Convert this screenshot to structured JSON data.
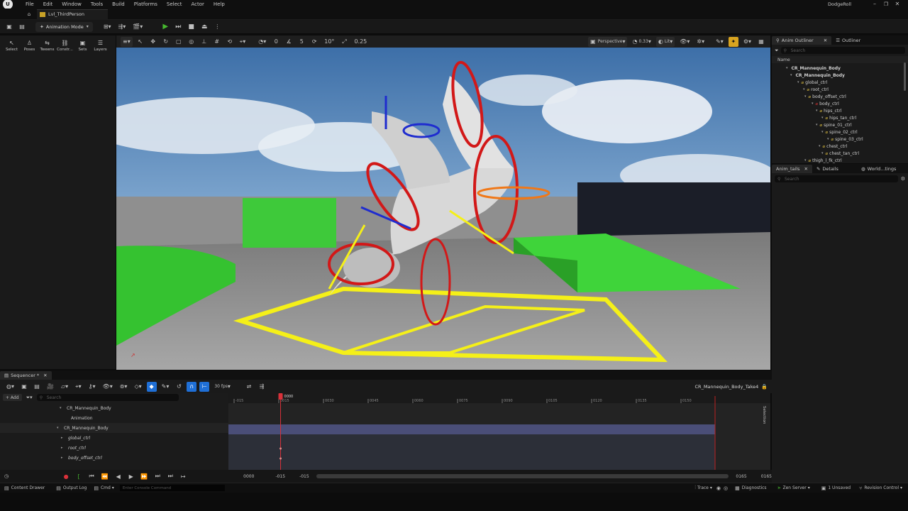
{
  "menu": [
    "File",
    "Edit",
    "Window",
    "Tools",
    "Build",
    "Platforms",
    "Select",
    "Actor",
    "Help"
  ],
  "project_name": "DodgeRoll",
  "level_tab": "Lvl_ThirdPerson",
  "toolbar": {
    "mode_label": "Animation Mode"
  },
  "anim_tools": [
    "Select",
    "Poses",
    "Tweens",
    "Constr...",
    "Sets",
    "Layers"
  ],
  "viewport": {
    "snap_angle": "5",
    "rot_snap": "10°",
    "scale_snap": "0.25",
    "view": "Perspective",
    "fov": "0.33",
    "lit": "Lit",
    "zero": "0"
  },
  "outliner": {
    "tab1": "Anim Outliner",
    "tab2": "Outliner",
    "search": "Search",
    "col_name": "Name",
    "items": [
      "CR_Mannequin_Body",
      "CR_Mannequin_Body",
      "global_ctrl",
      "root_ctrl",
      "body_offset_ctrl",
      "body_ctrl",
      "hips_ctrl",
      "hips_tan_ctrl",
      "spine_01_ctrl",
      "spine_02_ctrl",
      "spine_03_ctrl",
      "chest_ctrl",
      "chest_tan_ctrl",
      "thigh_l_fk_ctrl"
    ]
  },
  "details": {
    "tab1": "Anim_tails",
    "tab2": "Details",
    "tab3": "World...tings",
    "search": "Search"
  },
  "sequencer": {
    "tab": "Sequencer",
    "add": "+ Add",
    "search": "Search",
    "fps": "30 fps",
    "sequence_name": "CR_Mannequin_Body_Take4",
    "current_frame": "0000",
    "ticks": [
      "-015",
      "0015",
      "0030",
      "0045",
      "0060",
      "0075",
      "0090",
      "0105",
      "0120",
      "0135",
      "0150"
    ],
    "tracks": [
      "CR_Mannequin_Body",
      "Animation",
      "CR_Mannequin_Body",
      "global_ctrl",
      "root_ctrl",
      "body_offset_ctrl"
    ],
    "frame_field": "0000",
    "range_start": "-015",
    "range_start2": "-015",
    "range_end": "0165",
    "range_end2": "0165",
    "side_label": "Selection"
  },
  "statusbar": {
    "content_drawer": "Content Drawer",
    "output_log": "Output Log",
    "cmd": "Cmd",
    "console_placeholder": "Enter Console Command",
    "trace": "Trace",
    "diagnostics": "Diagnostics",
    "zen": "Zen Server",
    "unsaved": "1 Unsaved",
    "revision": "Revision Control"
  },
  "colors": {
    "accent_blue": "#1f6fd6",
    "play_green": "#46b82f",
    "playhead_red": "#d9313a",
    "track_select": "#4a4e78"
  }
}
